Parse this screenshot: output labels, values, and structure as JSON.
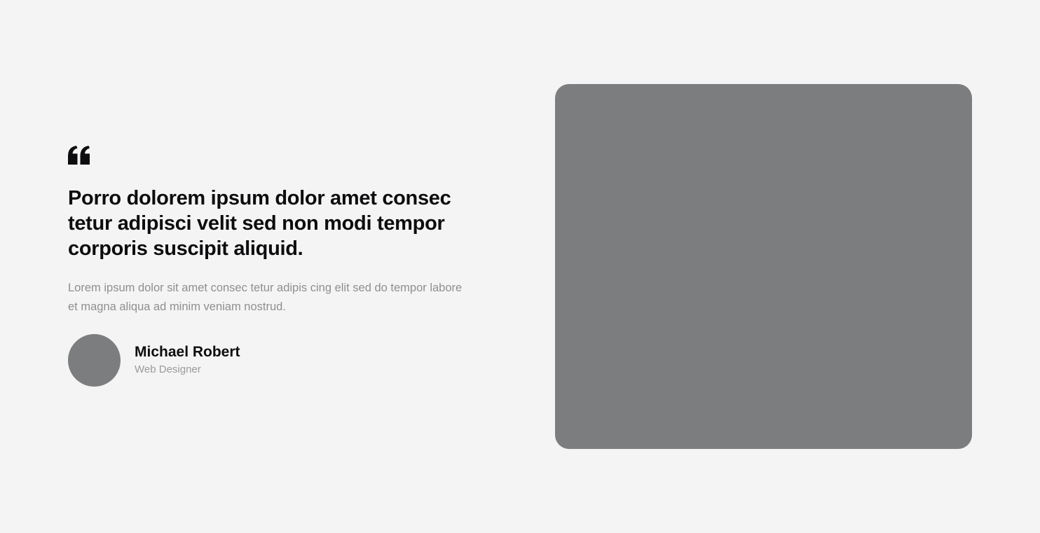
{
  "testimonial": {
    "quote_icon": "quote-open-icon",
    "quote": "Porro dolorem ipsum dolor amet consec tetur adipisci velit sed non modi tempor corporis suscipit aliquid.",
    "description": "Lorem ipsum dolor sit amet consec tetur adipis cing elit sed do tempor labore et magna aliqua ad minim veniam nostrud.",
    "author": {
      "name": "Michael Robert",
      "role": "Web Designer"
    }
  },
  "colors": {
    "background": "#f4f4f4",
    "heading": "#0d0d0f",
    "muted_text": "#8f8f92",
    "placeholder": "#7c7d7f"
  }
}
